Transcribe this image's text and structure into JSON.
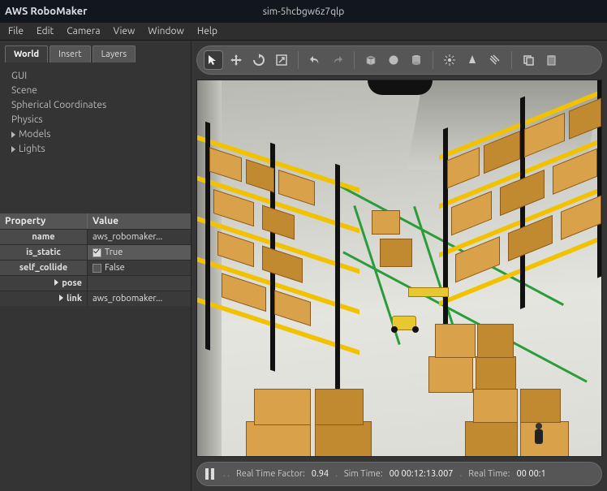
{
  "titlebar": {
    "app_name": "AWS RoboMaker",
    "sim_id": "sim-5hcbgw6z7qlp"
  },
  "menubar": {
    "items": [
      "File",
      "Edit",
      "Camera",
      "View",
      "Window",
      "Help"
    ]
  },
  "side_tabs": {
    "items": [
      "World",
      "Insert",
      "Layers"
    ],
    "active": 0
  },
  "world_tree": {
    "items": [
      {
        "label": "GUI",
        "expandable": false
      },
      {
        "label": "Scene",
        "expandable": false
      },
      {
        "label": "Spherical Coordinates",
        "expandable": false
      },
      {
        "label": "Physics",
        "expandable": false
      },
      {
        "label": "Models",
        "expandable": true
      },
      {
        "label": "Lights",
        "expandable": true
      }
    ]
  },
  "props": {
    "header_prop": "Property",
    "header_val": "Value",
    "rows": [
      {
        "key": "name",
        "val": "aws_robomaker...",
        "type": "text",
        "bold": true
      },
      {
        "key": "is_static",
        "val": "True",
        "type": "checkbox",
        "checked": true,
        "highlight": true
      },
      {
        "key": "self_collide",
        "val": "False",
        "type": "checkbox",
        "checked": false
      },
      {
        "key": "pose",
        "val": "",
        "type": "expand"
      },
      {
        "key": "link",
        "val": "aws_robomaker...",
        "type": "expand"
      }
    ]
  },
  "toolbar": {
    "items": [
      {
        "name": "select-arrow",
        "selected": true
      },
      {
        "name": "move"
      },
      {
        "name": "rotate"
      },
      {
        "name": "scale"
      },
      {
        "sep": true
      },
      {
        "name": "undo"
      },
      {
        "name": "redo"
      },
      {
        "sep": true
      },
      {
        "name": "primitive-cube"
      },
      {
        "name": "primitive-sphere"
      },
      {
        "name": "primitive-cylinder"
      },
      {
        "sep": true
      },
      {
        "name": "light-point"
      },
      {
        "name": "light-spot"
      },
      {
        "name": "light-directional"
      },
      {
        "sep": true
      },
      {
        "name": "copy"
      },
      {
        "name": "paste"
      }
    ]
  },
  "statusbar": {
    "rtf_label": "Real Time Factor:",
    "rtf_value": "0.94",
    "simtime_label": "Sim Time:",
    "simtime_value": "00 00:12:13.007",
    "realtime_label": "Real Time:",
    "realtime_value": "00 00:1"
  },
  "scene": {
    "description": "Warehouse interior 3D simulation viewed from elevated angle. Yellow metal shelving racks with cardboard boxes along left and right walls. Stacked box pallets on floor. Small yellow mobile robot near center. Green floor tape lines marking lanes. Overhead black dome lamp. Humanoid figure near lower-right boxes."
  }
}
